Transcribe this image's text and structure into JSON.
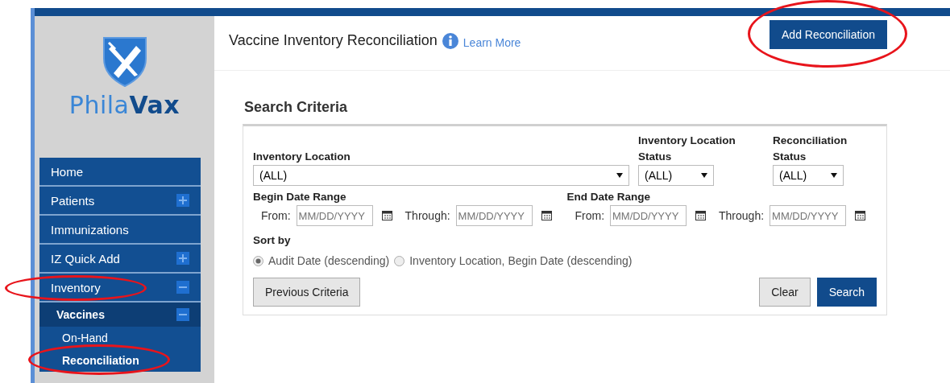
{
  "logo": {
    "text": "Phila**Vax**"
  },
  "nav": [
    {
      "label": "Home",
      "circled": false
    },
    {
      "label": "Patients",
      "expanded": false,
      "circled": false
    },
    {
      "label": "Immunizations",
      "circled": false
    },
    {
      "label": "IZ Quick Add",
      "expanded": false,
      "circled": false
    },
    {
      "label": "Inventory",
      "expanded": true,
      "circled": true,
      "children": [
        {
          "label": "Vaccines",
          "expanded": true,
          "circled": false,
          "children": [
            {
              "label": "On-Hand",
              "selected": false,
              "circled": false
            },
            {
              "label": "Reconciliation",
              "selected": true,
              "circled": true
            }
          ]
        }
      ]
    }
  ],
  "header": {
    "title": "Vaccine Inventory Reconciliation",
    "link": "Learn More",
    "button": {
      "label": "Add Reconciliation",
      "circled": true
    }
  },
  "search": {
    "title": "Search Criteria",
    "selects": [
      {
        "label": "Inventory Location",
        "value": "(ALL)"
      },
      {
        "label": "Inventory Location Status",
        "value": "(ALL)"
      },
      {
        "label": "Reconciliation Status",
        "value": "(ALL)"
      }
    ],
    "ranges": [
      {
        "label": "Begin Date Range",
        "from_label": "From:",
        "from_placeholder": "MM/DD/YYYY",
        "through_label": "Through:",
        "through_placeholder": "MM/DD/YYYY"
      },
      {
        "label": "End Date Range",
        "from_label": "From:",
        "from_placeholder": "MM/DD/YYYY",
        "through_label": "Through:",
        "through_placeholder": "MM/DD/YYYY"
      }
    ],
    "sort_label": "Sort by",
    "sort_options": [
      {
        "label": "Audit Date (descending)",
        "selected": true
      },
      {
        "label": "Inventory Location, Begin Date (descending)",
        "selected": false
      }
    ],
    "buttons": [
      {
        "label": "Previous Criteria",
        "kind": "secondary"
      },
      {
        "label": "Clear",
        "kind": "secondary"
      },
      {
        "label": "Search",
        "kind": "primary"
      }
    ]
  }
}
